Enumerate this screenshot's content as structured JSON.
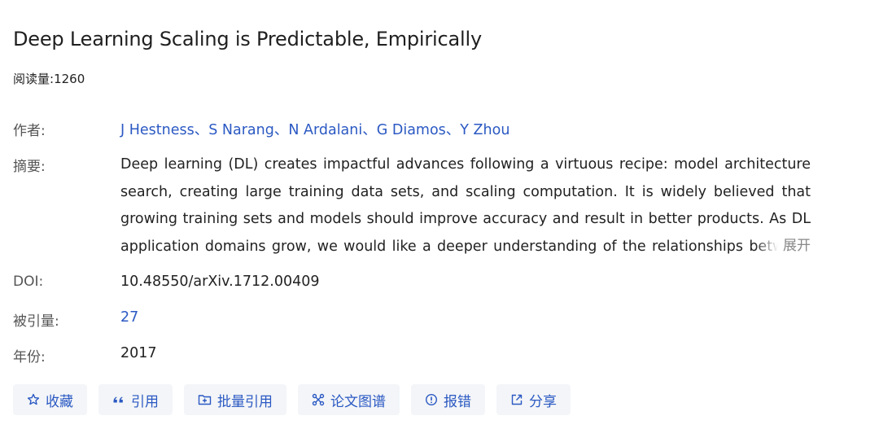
{
  "paper": {
    "title": "Deep Learning Scaling is Predictable, Empirically",
    "reads_label": "阅读量:",
    "reads_count": "1260"
  },
  "fields": {
    "authors_label": "作者:",
    "authors": [
      "J Hestness",
      "S Narang",
      "N Ardalani",
      "G Diamos",
      "Y Zhou"
    ],
    "author_separator": "、",
    "abstract_label": "摘要:",
    "abstract": "Deep learning (DL) creates impactful advances following a virtuous recipe: model architecture search, creating large training data sets, and scaling computation. It is widely believed that growing training sets and models should improve accuracy and result in better products. As DL application domains grow, we would like a deeper understanding of the relationships between training set size, computational scale, and model accuracy improvements to advance the state-of-the-art.",
    "expand_label": "展开",
    "doi_label": "DOI:",
    "doi": "10.48550/arXiv.1712.00409",
    "citations_label": "被引量:",
    "citations": "27",
    "year_label": "年份:",
    "year": "2017"
  },
  "actions": {
    "favorite": {
      "label": "收藏",
      "icon": "star-icon"
    },
    "cite": {
      "label": "引用",
      "icon": "quote-icon"
    },
    "batch_cite": {
      "label": "批量引用",
      "icon": "folder-plus-icon"
    },
    "graph": {
      "label": "论文图谱",
      "icon": "graph-icon"
    },
    "report": {
      "label": "报错",
      "icon": "alert-icon"
    },
    "share": {
      "label": "分享",
      "icon": "share-icon"
    }
  },
  "colors": {
    "link": "#2b59c3",
    "label": "#555555",
    "button_bg": "#f3f5f8",
    "expand": "#888888"
  }
}
